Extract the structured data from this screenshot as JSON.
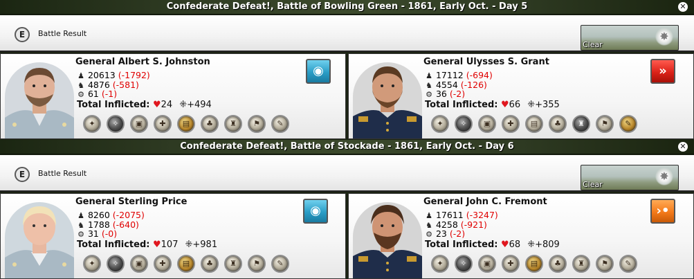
{
  "reports": [
    {
      "title": "Confederate Defeat!, Battle of Bowling Green - 1861, Early Oct. - Day 5",
      "result_label": "Battle Result",
      "e_badge": "E",
      "clear_label": "Clear",
      "left": {
        "general": "General Albert S. Johnston",
        "infantry": "20613",
        "infantry_loss": "(-1792)",
        "cavalry": "4876",
        "cavalry_loss": "(-581)",
        "artillery": "61",
        "artillery_loss": "(-1)",
        "inflicted_label": "Total Inflicted:",
        "casualties": "24",
        "gain": "+494",
        "posture_icon": "defend-posture-icon",
        "posture_color": "#2a9dc6"
      },
      "right": {
        "general": "General Ulysses S. Grant",
        "infantry": "17112",
        "infantry_loss": "(-694)",
        "cavalry": "4554",
        "cavalry_loss": "(-126)",
        "artillery": "36",
        "artillery_loss": "(-2)",
        "inflicted_label": "Total Inflicted:",
        "casualties": "66",
        "gain": "+355",
        "posture_icon": "assault-posture-icon",
        "posture_color": "#db2219"
      }
    },
    {
      "title": "Confederate Defeat!, Battle of Stockade - 1861, Early Oct. - Day 6",
      "result_label": "Battle Result",
      "e_badge": "E",
      "clear_label": "Clear",
      "left": {
        "general": "General Sterling Price",
        "infantry": "8260",
        "infantry_loss": "(-2075)",
        "cavalry": "1788",
        "cavalry_loss": "(-640)",
        "artillery": "31",
        "artillery_loss": "(-0)",
        "inflicted_label": "Total Inflicted:",
        "casualties": "107",
        "gain": "+981",
        "posture_icon": "defend-posture-icon",
        "posture_color": "#2a9dc6"
      },
      "right": {
        "general": "General John C. Fremont",
        "infantry": "17611",
        "infantry_loss": "(-3247)",
        "cavalry": "4258",
        "cavalry_loss": "(-921)",
        "artillery": "23",
        "artillery_loss": "(-2)",
        "inflicted_label": "Total Inflicted:",
        "casualties": "68",
        "gain": "+809",
        "posture_icon": "attack-posture-icon",
        "posture_color": "#f47a1a"
      }
    }
  ],
  "colors": {
    "loss_red": "#e00000",
    "title_bar": "#2e3a22",
    "confederate_gray": "#a9b9c4",
    "union_blue": "#1f2d4a"
  }
}
